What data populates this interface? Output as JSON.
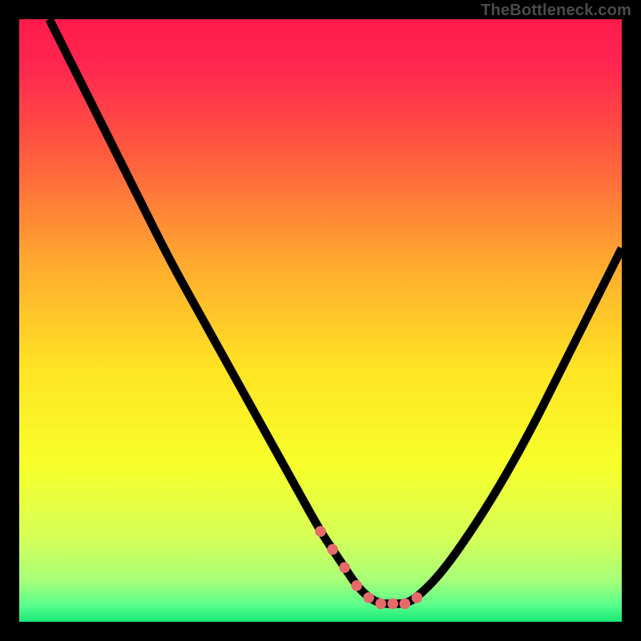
{
  "watermark": "TheBottleneck.com",
  "chart_data": {
    "type": "line",
    "title": "",
    "xlabel": "",
    "ylabel": "",
    "xlim": [
      0,
      100
    ],
    "ylim": [
      0,
      100
    ],
    "grid": false,
    "background_gradient": [
      {
        "stop": 0.0,
        "color": "#ff1a4b"
      },
      {
        "stop": 0.08,
        "color": "#ff2750"
      },
      {
        "stop": 0.22,
        "color": "#ff5a3f"
      },
      {
        "stop": 0.4,
        "color": "#ffa82f"
      },
      {
        "stop": 0.58,
        "color": "#ffe423"
      },
      {
        "stop": 0.74,
        "color": "#f7ff2a"
      },
      {
        "stop": 0.86,
        "color": "#d6ff57"
      },
      {
        "stop": 0.93,
        "color": "#a8ff77"
      },
      {
        "stop": 0.97,
        "color": "#5fff8c"
      },
      {
        "stop": 1.0,
        "color": "#19e877"
      }
    ],
    "series": [
      {
        "name": "curve",
        "color": "#000000",
        "x": [
          5,
          10,
          15,
          20,
          25,
          30,
          35,
          40,
          45,
          50,
          52,
          54,
          56,
          58,
          60,
          62,
          64,
          66,
          70,
          75,
          80,
          85,
          90,
          95,
          100
        ],
        "y": [
          100,
          90,
          80,
          70,
          60,
          51,
          42,
          33,
          24,
          15,
          12,
          9,
          6,
          4,
          3,
          3,
          3,
          4,
          8,
          15,
          23,
          32,
          42,
          52,
          62
        ]
      }
    ],
    "markers": {
      "name": "valley-dots",
      "color": "#e66a6a",
      "radius_pct": 0.9,
      "x": [
        50,
        52,
        54,
        56,
        58,
        60,
        62,
        64,
        66
      ],
      "y": [
        15,
        12,
        9,
        6,
        4,
        3,
        3,
        3,
        4
      ]
    }
  }
}
